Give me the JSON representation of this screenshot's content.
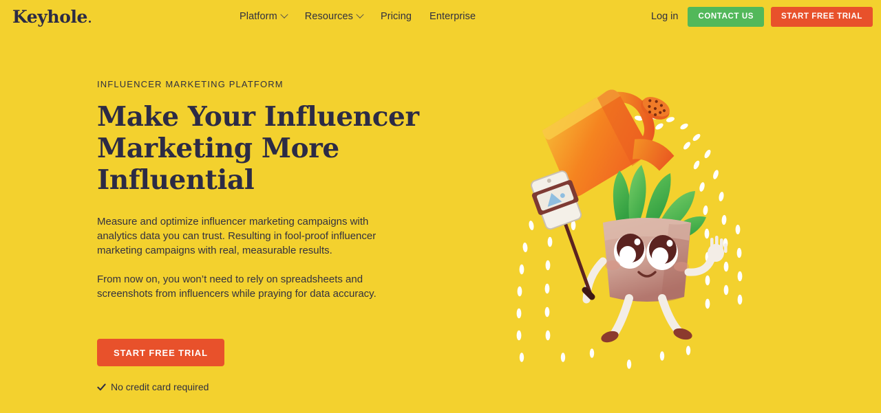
{
  "brand": {
    "name": "Keyhole",
    "trademark_dot": "."
  },
  "header": {
    "nav": [
      {
        "label": "Platform",
        "has_dropdown": true,
        "icon": "chevron-down-icon"
      },
      {
        "label": "Resources",
        "has_dropdown": true,
        "icon": "chevron-down-icon"
      },
      {
        "label": "Pricing",
        "has_dropdown": false,
        "icon": ""
      },
      {
        "label": "Enterprise",
        "has_dropdown": false,
        "icon": ""
      }
    ],
    "login_label": "Log in",
    "contact_label": "CONTACT US",
    "trial_label": "START FREE TRIAL"
  },
  "hero": {
    "eyebrow": "INFLUENCER MARKETING PLATFORM",
    "headline_line1": "Make Your Influencer",
    "headline_line2": "Marketing More Influential",
    "paragraph1": "Measure and optimize influencer marketing campaigns with analytics data you can trust. Resulting in fool-proof influencer marketing campaigns with real, measurable results.",
    "paragraph2": "From now on, you won’t need to rely on spreadsheets and screenshots from influencers while praying for data accuracy.",
    "cta_label": "START FREE TRIAL",
    "assurance_label": "No credit card required",
    "assurance_icon": "check-icon"
  },
  "illustration": {
    "description": "Orange watering can spraying white water droplets over a smiling plant-pot mascot with green leaves holding a selfie stick",
    "elements": [
      "watering-can",
      "water-droplet-spray",
      "plant-mascot",
      "selfie-stick-phone"
    ]
  },
  "colors": {
    "background": "#F3D12E",
    "ink": "#2C2B45",
    "accent_red": "#E8512B",
    "accent_green": "#52B85A",
    "leaf_green": "#4DB847",
    "can_orange": "#F0622A",
    "droplet_white": "#FFFFFF"
  }
}
